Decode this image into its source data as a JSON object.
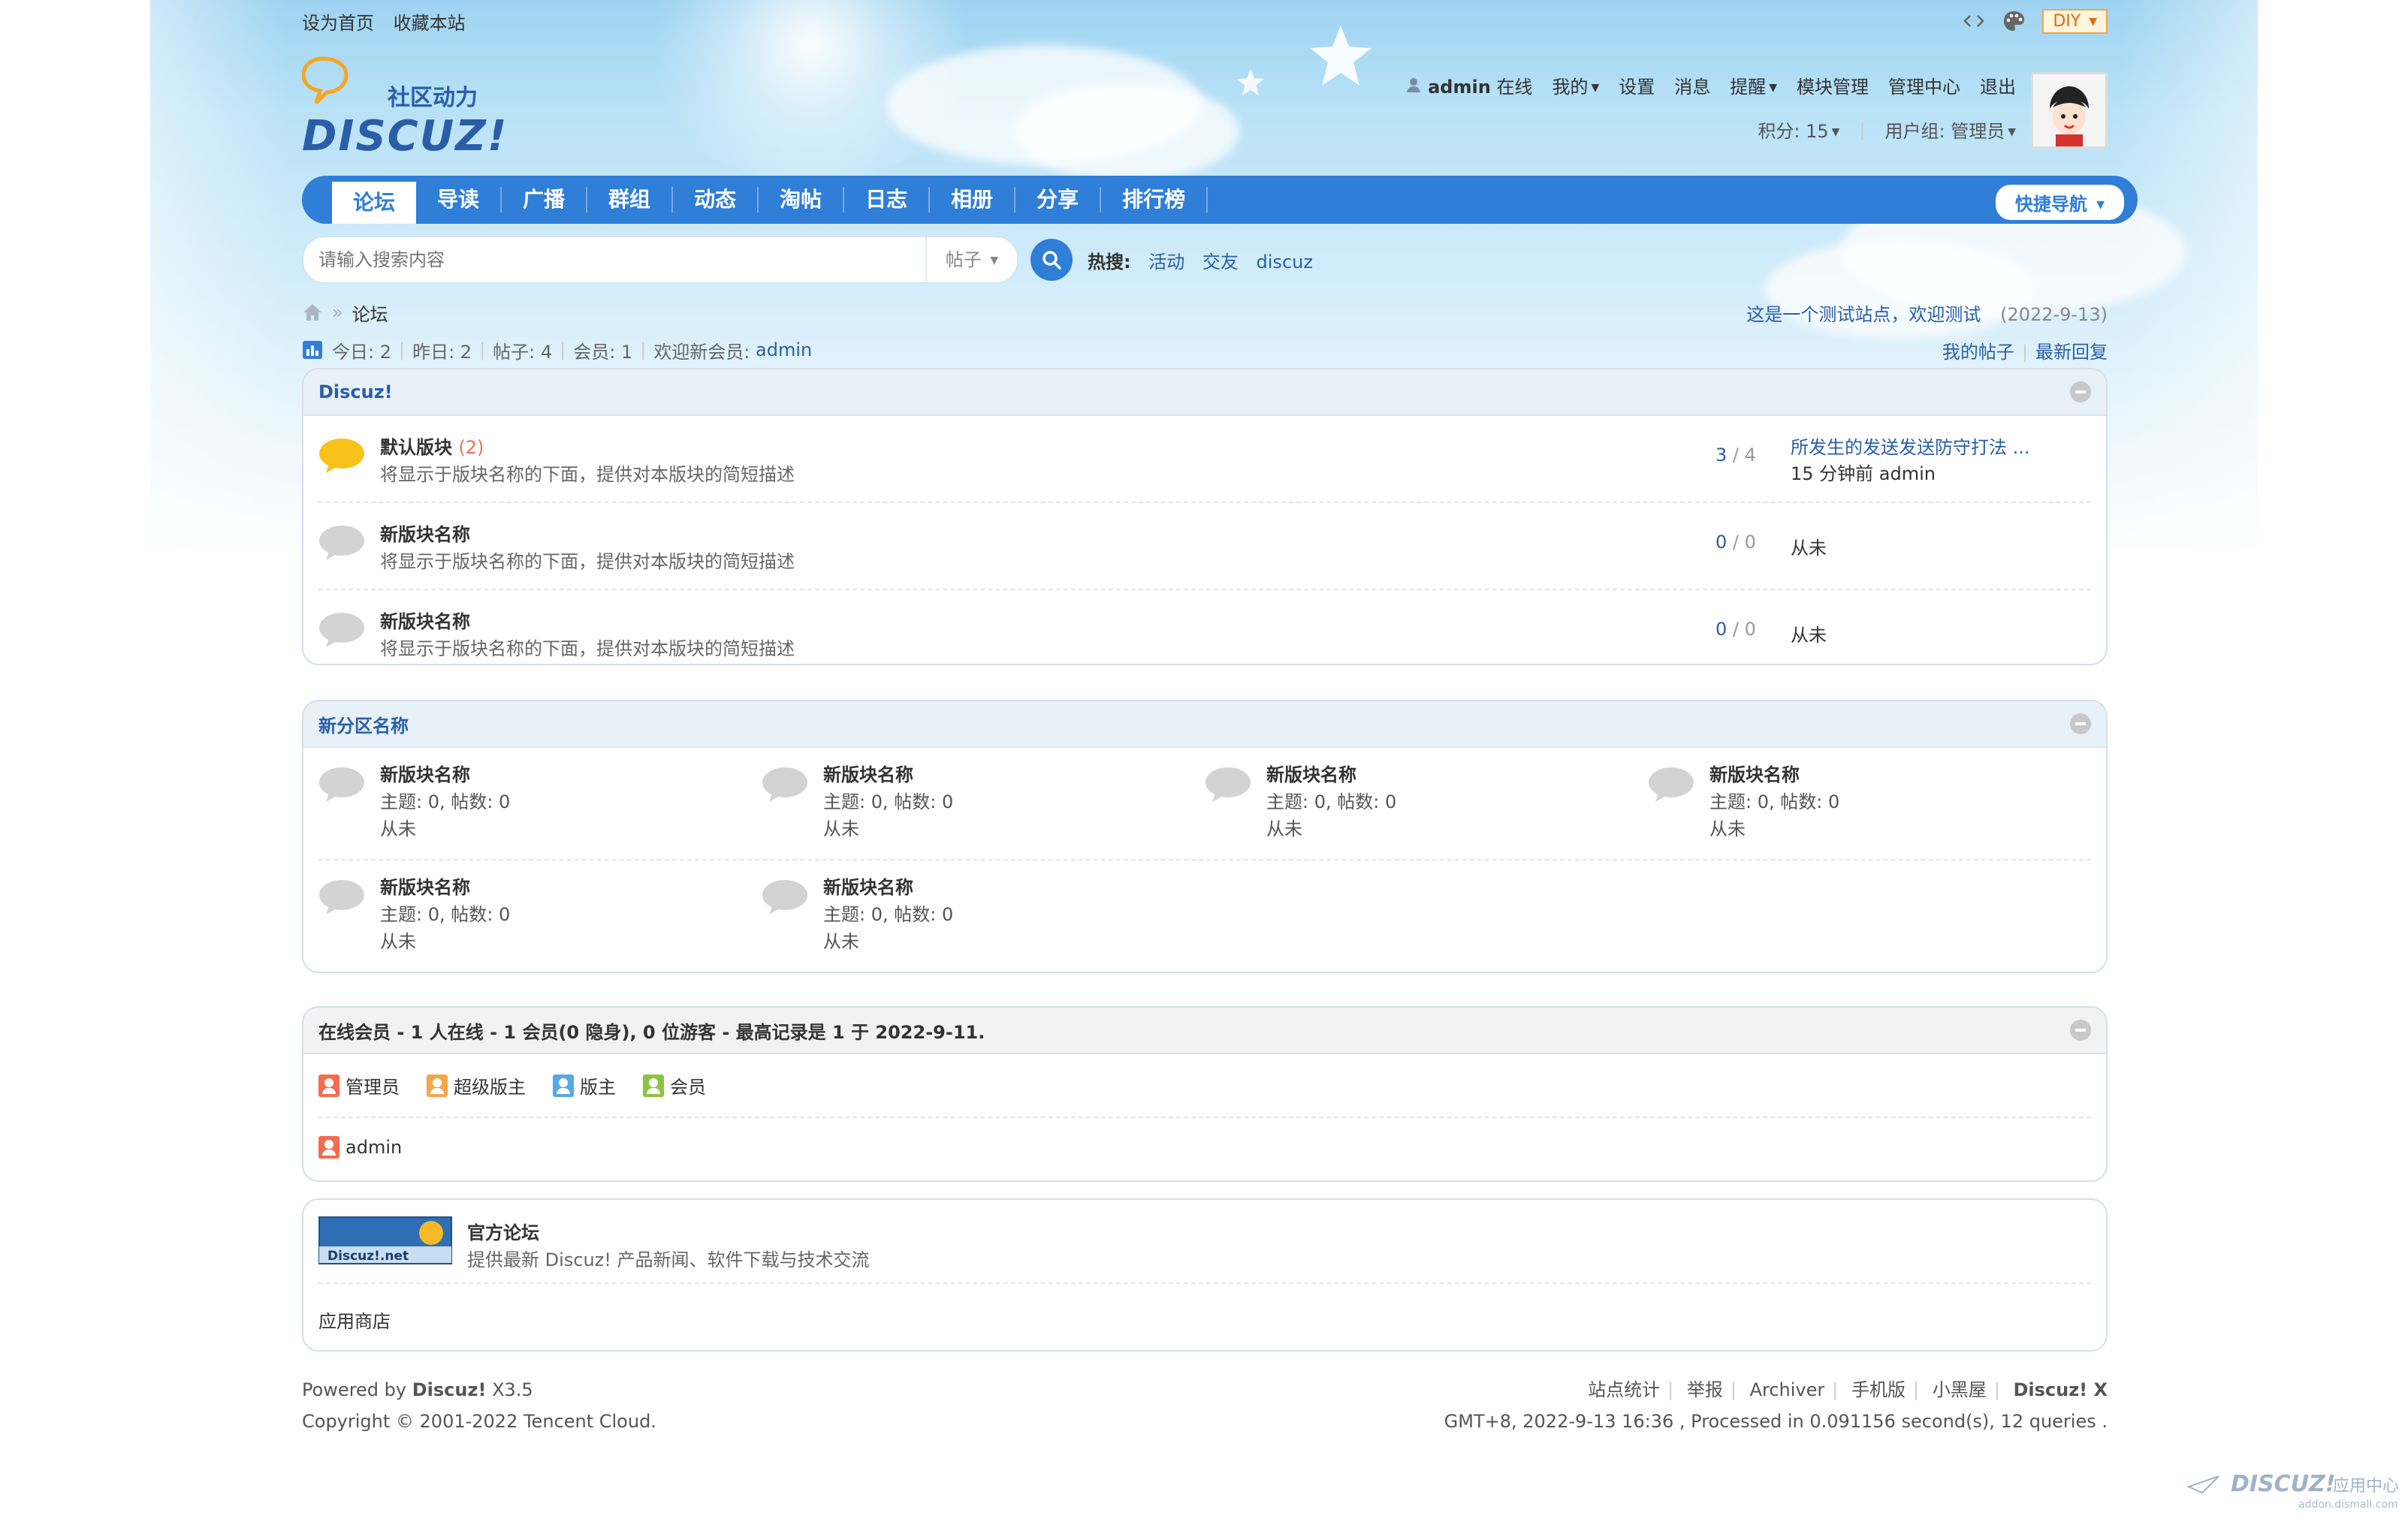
{
  "topbar": {
    "set_home": "设为首页",
    "bookmark": "收藏本站",
    "diy": "DIY"
  },
  "logo": {
    "tagline": "社区动力",
    "brand": "DISCUZ!"
  },
  "user": {
    "name": "admin",
    "status": "在线",
    "menu": [
      "我的",
      "设置",
      "消息",
      "提醒",
      "模块管理",
      "管理中心",
      "退出"
    ],
    "credits": "积分: 15",
    "group": "用户组: 管理员"
  },
  "nav": {
    "items": [
      "论坛",
      "导读",
      "广播",
      "群组",
      "动态",
      "淘帖",
      "日志",
      "相册",
      "分享",
      "排行榜"
    ],
    "active": "论坛",
    "quick_nav": "快捷导航"
  },
  "search": {
    "placeholder": "请输入搜索内容",
    "type": "帖子",
    "hot_label": "热搜:",
    "hot_terms": [
      "活动",
      "交友",
      "discuz"
    ]
  },
  "breadcrumb": {
    "current": "论坛",
    "notice": "这是一个测试站点，欢迎测试",
    "notice_date": "(2022-9-13)"
  },
  "stats": {
    "today": "今日: 2",
    "yesterday": "昨日: 2",
    "posts": "帖子: 4",
    "members": "会员: 1",
    "welcome": "欢迎新会员:",
    "new_member": "admin",
    "my_posts": "我的帖子",
    "latest_replies": "最新回复"
  },
  "category1": {
    "title": "Discuz!",
    "forums": [
      {
        "name": "默认版块",
        "count": "(2)",
        "desc": "将显示于版块名称的下面，提供对本版块的简短描述",
        "threads": "3",
        "posts": "4",
        "last_title": "所发生的发送发送防守打法 ...",
        "last_meta": "15 分钟前 admin"
      },
      {
        "name": "新版块名称",
        "count": "",
        "desc": "将显示于版块名称的下面，提供对本版块的简短描述",
        "threads": "0",
        "posts": "0",
        "last_title": "从未",
        "last_meta": ""
      },
      {
        "name": "新版块名称",
        "count": "",
        "desc": "将显示于版块名称的下面，提供对本版块的简短描述",
        "threads": "0",
        "posts": "0",
        "last_title": "从未",
        "last_meta": ""
      }
    ]
  },
  "category2": {
    "title": "新分区名称",
    "forums": [
      {
        "name": "新版块名称",
        "stat": "主题: 0, 帖数: 0",
        "last": "从未"
      },
      {
        "name": "新版块名称",
        "stat": "主题: 0, 帖数: 0",
        "last": "从未"
      },
      {
        "name": "新版块名称",
        "stat": "主题: 0, 帖数: 0",
        "last": "从未"
      },
      {
        "name": "新版块名称",
        "stat": "主题: 0, 帖数: 0",
        "last": "从未"
      },
      {
        "name": "新版块名称",
        "stat": "主题: 0, 帖数: 0",
        "last": "从未"
      },
      {
        "name": "新版块名称",
        "stat": "主题: 0, 帖数: 0",
        "last": "从未"
      }
    ]
  },
  "online": {
    "title": "在线会员 - 1 人在线 - 1 会员(0 隐身), 0 位游客 - 最高记录是 1 于 2022-9-11.",
    "legend": [
      {
        "label": "管理员",
        "color": "#f26c4f"
      },
      {
        "label": "超级版主",
        "color": "#f5a54a"
      },
      {
        "label": "版主",
        "color": "#56a8e8"
      },
      {
        "label": "会员",
        "color": "#8cc43f"
      }
    ],
    "users": [
      "admin"
    ]
  },
  "links": {
    "badge_text": "Discuz!.net",
    "name": "官方论坛",
    "desc": "提供最新 Discuz! 产品新闻、软件下载与技术交流",
    "extra": "应用商店"
  },
  "footer": {
    "powered_prefix": "Powered by",
    "powered_brand": "Discuz!",
    "powered_version": "X3.5",
    "copyright": "Copyright © 2001-2022 Tencent Cloud.",
    "links": [
      "站点统计",
      "举报",
      "Archiver",
      "手机版",
      "小黑屋"
    ],
    "brand_right": "Discuz! X",
    "timing": "GMT+8, 2022-9-13 16:36 , Processed in 0.091156 second(s), 12 queries ."
  },
  "watermark": {
    "brand": "DISCUZ!",
    "label": "应用中心",
    "url": "addon.dismall.com"
  },
  "colors": {
    "accent": "#2f7ed8",
    "link": "#2a5ea8",
    "hot_count": "#f26c4f"
  }
}
